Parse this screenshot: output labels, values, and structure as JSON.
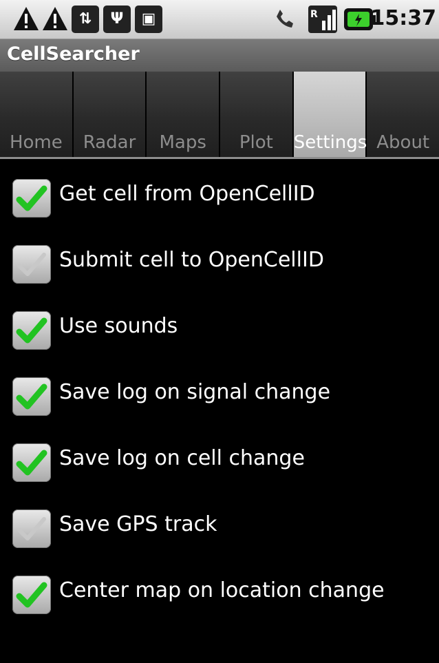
{
  "status_bar": {
    "time": "15:37",
    "icons": [
      "warning-icon",
      "warning-icon",
      "data-transfer-icon",
      "usb-icon",
      "android-icon",
      "phone-icon",
      "signal-icon",
      "battery-icon"
    ]
  },
  "app": {
    "title": "CellSearcher"
  },
  "tabs": [
    {
      "label": "Home",
      "active": false
    },
    {
      "label": "Radar",
      "active": false
    },
    {
      "label": "Maps",
      "active": false
    },
    {
      "label": "Plot",
      "active": false
    },
    {
      "label": "Settings",
      "active": true
    },
    {
      "label": "About",
      "active": false
    }
  ],
  "settings": [
    {
      "label": "Get cell from OpenCellID",
      "checked": true
    },
    {
      "label": "Submit cell to OpenCellID",
      "checked": false
    },
    {
      "label": "Use sounds",
      "checked": true
    },
    {
      "label": "Save log on signal change",
      "checked": true
    },
    {
      "label": "Save log on cell change",
      "checked": true
    },
    {
      "label": "Save GPS track",
      "checked": false
    },
    {
      "label": "Center map on location change",
      "checked": true
    }
  ],
  "colors": {
    "check_on": "#22c322",
    "check_off": "#c8c8c8"
  }
}
